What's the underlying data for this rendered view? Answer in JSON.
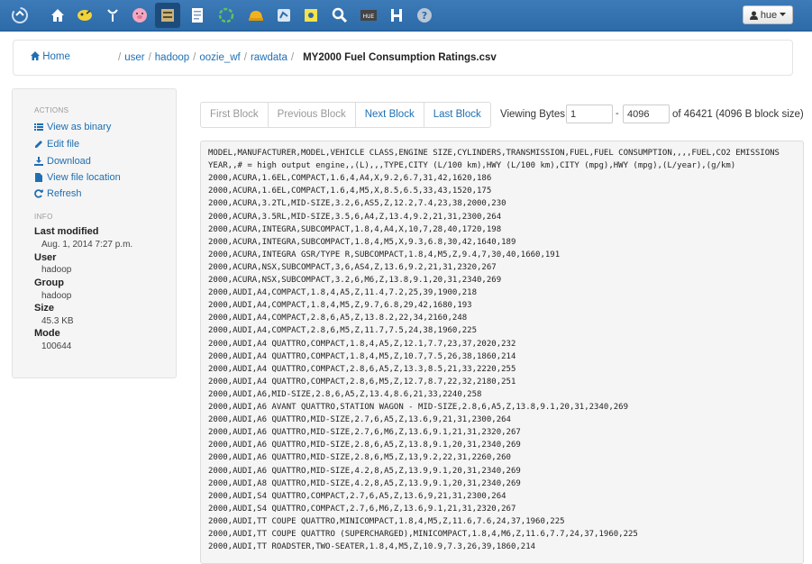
{
  "navbar": {
    "icons": [
      "hue-logo-icon",
      "home-icon",
      "query-editor-icon",
      "pig-tool-icon",
      "pig-icon",
      "file-browser-icon",
      "job-designer-icon",
      "oozie-icon",
      "hard-hat-icon",
      "metastore-icon",
      "sticky-note-icon",
      "search-icon",
      "hive-icon",
      "hbase-icon",
      "help-icon"
    ],
    "user_label": "hue",
    "colors": {
      "bar": "#2c6aa8",
      "active": "#1e4c7a"
    }
  },
  "breadcrumb": {
    "home": "Home",
    "segments": [
      "user",
      "hadoop",
      "oozie_wf",
      "rawdata"
    ],
    "file": "MY2000 Fuel Consumption Ratings.csv"
  },
  "sidebar": {
    "actions_header": "ACTIONS",
    "actions": [
      {
        "label": "View as binary",
        "icon": "list-icon"
      },
      {
        "label": "Edit file",
        "icon": "pencil-icon"
      },
      {
        "label": "Download",
        "icon": "download-icon"
      },
      {
        "label": "View file location",
        "icon": "file-icon"
      },
      {
        "label": "Refresh",
        "icon": "refresh-icon"
      }
    ],
    "info_header": "INFO",
    "info": [
      {
        "label": "Last modified",
        "value": "Aug. 1, 2014 7:27 p.m."
      },
      {
        "label": "User",
        "value": "hadoop"
      },
      {
        "label": "Group",
        "value": "hadoop"
      },
      {
        "label": "Size",
        "value": "45.3 KB"
      },
      {
        "label": "Mode",
        "value": "100644"
      }
    ]
  },
  "pager": {
    "first": "First Block",
    "previous": "Previous Block",
    "next": "Next Block",
    "last": "Last Block"
  },
  "viewing": {
    "label": "Viewing Bytes:",
    "from": "1",
    "to": "4096",
    "total": "of 46421 (4096 B block size)"
  },
  "file_lines": [
    "MODEL,MANUFACTURER,MODEL,VEHICLE CLASS,ENGINE SIZE,CYLINDERS,TRANSMISSION,FUEL,FUEL CONSUMPTION,,,,FUEL,CO2 EMISSIONS",
    "YEAR,,# = high output engine,,(L),,,TYPE,CITY (L/100 km),HWY (L/100 km),CITY (mpg),HWY (mpg),(L/year),(g/km)",
    "2000,ACURA,1.6EL,COMPACT,1.6,4,A4,X,9.2,6.7,31,42,1620,186",
    "2000,ACURA,1.6EL,COMPACT,1.6,4,M5,X,8.5,6.5,33,43,1520,175",
    "2000,ACURA,3.2TL,MID-SIZE,3.2,6,AS5,Z,12.2,7.4,23,38,2000,230",
    "2000,ACURA,3.5RL,MID-SIZE,3.5,6,A4,Z,13.4,9.2,21,31,2300,264",
    "2000,ACURA,INTEGRA,SUBCOMPACT,1.8,4,A4,X,10,7,28,40,1720,198",
    "2000,ACURA,INTEGRA,SUBCOMPACT,1.8,4,M5,X,9.3,6.8,30,42,1640,189",
    "2000,ACURA,INTEGRA GSR/TYPE R,SUBCOMPACT,1.8,4,M5,Z,9.4,7,30,40,1660,191",
    "2000,ACURA,NSX,SUBCOMPACT,3,6,AS4,Z,13.6,9.2,21,31,2320,267",
    "2000,ACURA,NSX,SUBCOMPACT,3.2,6,M6,Z,13.8,9.1,20,31,2340,269",
    "2000,AUDI,A4,COMPACT,1.8,4,A5,Z,11.4,7.2,25,39,1900,218",
    "2000,AUDI,A4,COMPACT,1.8,4,M5,Z,9.7,6.8,29,42,1680,193",
    "2000,AUDI,A4,COMPACT,2.8,6,A5,Z,13.8.2,22,34,2160,248",
    "2000,AUDI,A4,COMPACT,2.8,6,M5,Z,11.7,7.5,24,38,1960,225",
    "2000,AUDI,A4 QUATTRO,COMPACT,1.8,4,A5,Z,12.1,7.7,23,37,2020,232",
    "2000,AUDI,A4 QUATTRO,COMPACT,1.8,4,M5,Z,10.7,7.5,26,38,1860,214",
    "2000,AUDI,A4 QUATTRO,COMPACT,2.8,6,A5,Z,13.3,8.5,21,33,2220,255",
    "2000,AUDI,A4 QUATTRO,COMPACT,2.8,6,M5,Z,12.7,8.7,22,32,2180,251",
    "2000,AUDI,A6,MID-SIZE,2.8,6,A5,Z,13.4,8.6,21,33,2240,258",
    "2000,AUDI,A6 AVANT QUATTRO,STATION WAGON - MID-SIZE,2.8,6,A5,Z,13.8,9.1,20,31,2340,269",
    "2000,AUDI,A6 QUATTRO,MID-SIZE,2.7,6,A5,Z,13.6,9,21,31,2300,264",
    "2000,AUDI,A6 QUATTRO,MID-SIZE,2.7,6,M6,Z,13.6,9.1,21,31,2320,267",
    "2000,AUDI,A6 QUATTRO,MID-SIZE,2.8,6,A5,Z,13.8,9.1,20,31,2340,269",
    "2000,AUDI,A6 QUATTRO,MID-SIZE,2.8,6,M5,Z,13,9.2,22,31,2260,260",
    "2000,AUDI,A6 QUATTRO,MID-SIZE,4.2,8,A5,Z,13.9,9.1,20,31,2340,269",
    "2000,AUDI,A8 QUATTRO,MID-SIZE,4.2,8,A5,Z,13.9,9.1,20,31,2340,269",
    "2000,AUDI,S4 QUATTRO,COMPACT,2.7,6,A5,Z,13.6,9,21,31,2300,264",
    "2000,AUDI,S4 QUATTRO,COMPACT,2.7,6,M6,Z,13.6,9.1,21,31,2320,267",
    "2000,AUDI,TT COUPE QUATTRO,MINICOMPACT,1.8,4,M5,Z,11.6,7.6,24,37,1960,225",
    "2000,AUDI,TT COUPE QUATTRO (SUPERCHARGED),MINICOMPACT,1.8,4,M6,Z,11.6,7.7,24,37,1960,225",
    "2000,AUDI,TT ROADSTER,TWO-SEATER,1.8,4,M5,Z,10.9,7.3,26,39,1860,214"
  ]
}
